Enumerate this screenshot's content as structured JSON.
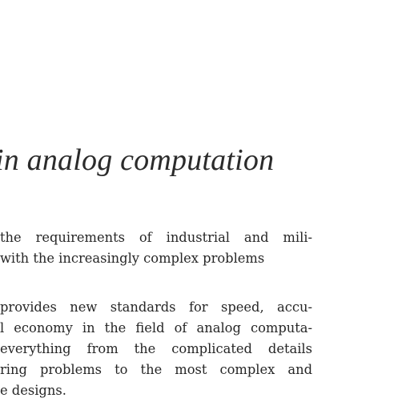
{
  "title": "in analog computation",
  "paragraphs": [
    {
      "lines": [
        "the requirements of industrial and mili-",
        "with the increasingly complex problems"
      ]
    },
    {
      "lines": [
        "provides new standards for speed, accu-",
        "l economy in the field of analog computa-",
        "everything from the complicated details",
        "ring problems to the most complex and",
        "e designs."
      ]
    }
  ]
}
